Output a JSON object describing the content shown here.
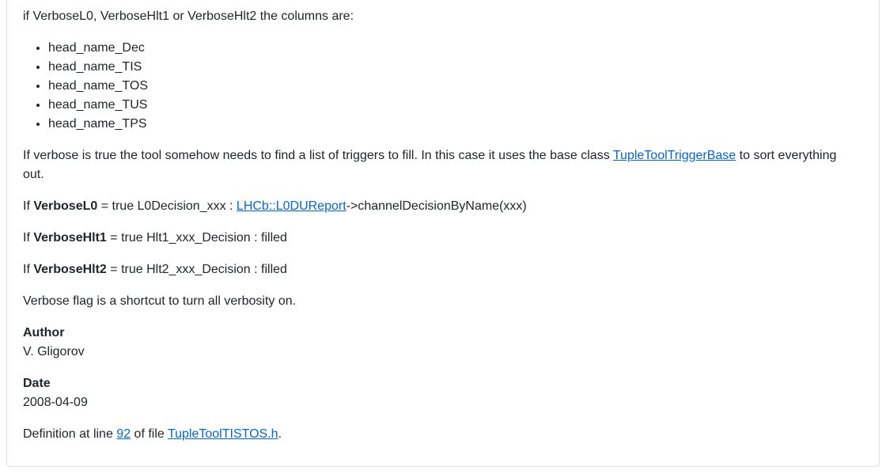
{
  "intro": "if VerboseL0, VerboseHlt1 or VerboseHlt2 the columns are:",
  "columns": [
    "head_name_Dec",
    "head_name_TIS",
    "head_name_TOS",
    "head_name_TUS",
    "head_name_TPS"
  ],
  "verbose_para": {
    "before": "If verbose is true the tool somehow needs to find a list of triggers to fill. In this case it uses the base class ",
    "link": "TupleToolTriggerBase",
    "after": " to sort everything out."
  },
  "l0_line": {
    "prefix": "If ",
    "key": "VerboseL0",
    "middle": " = true L0Decision_xxx : ",
    "link": "LHCb::L0DUReport",
    "suffix": "->channelDecisionByName(xxx)"
  },
  "hlt1_line": {
    "prefix": "If ",
    "key": "VerboseHlt1",
    "rest": " = true Hlt1_xxx_Decision : filled"
  },
  "hlt2_line": {
    "prefix": "If ",
    "key": "VerboseHlt2",
    "rest": " = true Hlt2_xxx_Decision : filled"
  },
  "shortcut": "Verbose flag is a shortcut to turn all verbosity on.",
  "author": {
    "label": "Author",
    "value": "V. Gligorov"
  },
  "date": {
    "label": "Date",
    "value": "2008-04-09"
  },
  "definition": {
    "prefix": "Definition at line ",
    "line_link": "92",
    "middle": " of file ",
    "file_link": "TupleToolTISTOS.h",
    "suffix": "."
  },
  "colors": {
    "link": "#0366d6",
    "text": "#212529",
    "border": "#dfdfdf"
  }
}
